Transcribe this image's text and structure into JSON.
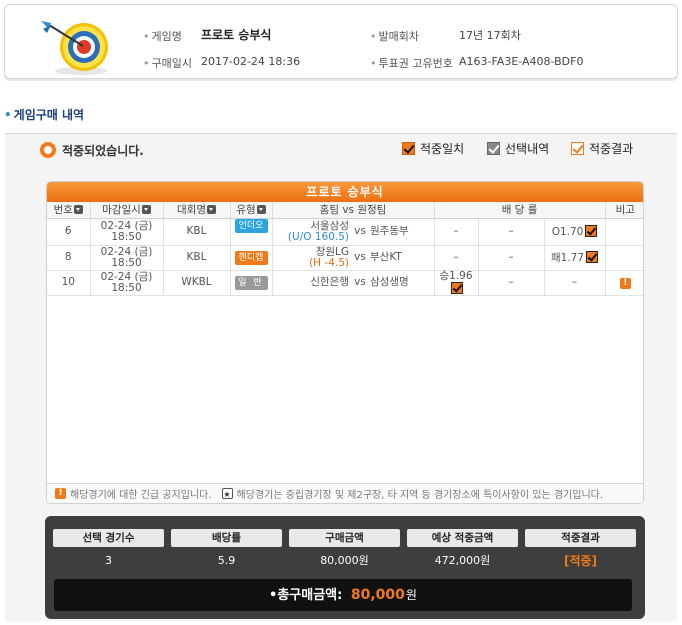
{
  "info": {
    "game_name_label": "게임명",
    "game_name": "프로토 승부식",
    "purchase_date_label": "구매일시",
    "purchase_date": "2017-02-24 18:36",
    "round_label": "발매회차",
    "round": "17년 17회차",
    "ticket_id_label": "투표권 고유번호",
    "ticket_id": "A163-FA3E-A408-BDF0"
  },
  "section_title": "게임구매 내역",
  "result_text": "적중되었습니다.",
  "legend": {
    "hit_match": "적중일치",
    "selection": "선택내역",
    "hit_result": "적중결과"
  },
  "table": {
    "title": "프로토 승부식",
    "headers": {
      "no": "번호",
      "deadline": "마감일시",
      "league": "대회명",
      "type": "유형",
      "teams": "홈팀 vs 원정팀",
      "odds": "배 당 률",
      "note": "비고"
    },
    "rows": [
      {
        "no": "6",
        "date": "02-24 (금)",
        "time": "18:50",
        "league": "KBL",
        "type": "언더오버",
        "home": "서울삼성",
        "home_sub": "(U/O 160.5)",
        "vs": "vs",
        "away": "원주동부",
        "odd1": "–",
        "odd2": "–",
        "odd3": "O1.70"
      },
      {
        "no": "8",
        "date": "02-24 (금)",
        "time": "18:50",
        "league": "KBL",
        "type": "핸디캡",
        "home": "창원LG",
        "home_sub": "(H -4.5)",
        "vs": "vs",
        "away": "부산KT",
        "odd1": "–",
        "odd2": "–",
        "odd3": "패1.77"
      },
      {
        "no": "10",
        "date": "02-24 (금)",
        "time": "18:50",
        "league": "WKBL",
        "type": "일 반",
        "home": "신한은행",
        "home_sub": "",
        "vs": "vs",
        "away": "삼성생명",
        "odd1": "승1.96",
        "odd2": "–",
        "odd3": "–",
        "note": "!"
      }
    ]
  },
  "notice": {
    "urgent_icon": "!",
    "urgent_text": "해당경기에 대한 긴급 공지입니다.",
    "star_icon": "★",
    "star_text": "해당경기는 중립경기장 및 제2구장, 타 지역 등 경기장소에 특이사항이 있는 경기입니다."
  },
  "summary": {
    "headers": [
      "선택 경기수",
      "배당률",
      "구매금액",
      "예상 적중금액",
      "적중결과"
    ],
    "values": [
      "3",
      "5.9",
      "80,000원",
      "472,000원",
      "[적중]"
    ],
    "total_label": "총구매금액:",
    "total_amount": "80,000",
    "total_unit": "원"
  },
  "colors": {
    "accent": "#f07a1a",
    "title_blue": "#1d3f7a",
    "summary_bg": "#3e3e3e"
  }
}
